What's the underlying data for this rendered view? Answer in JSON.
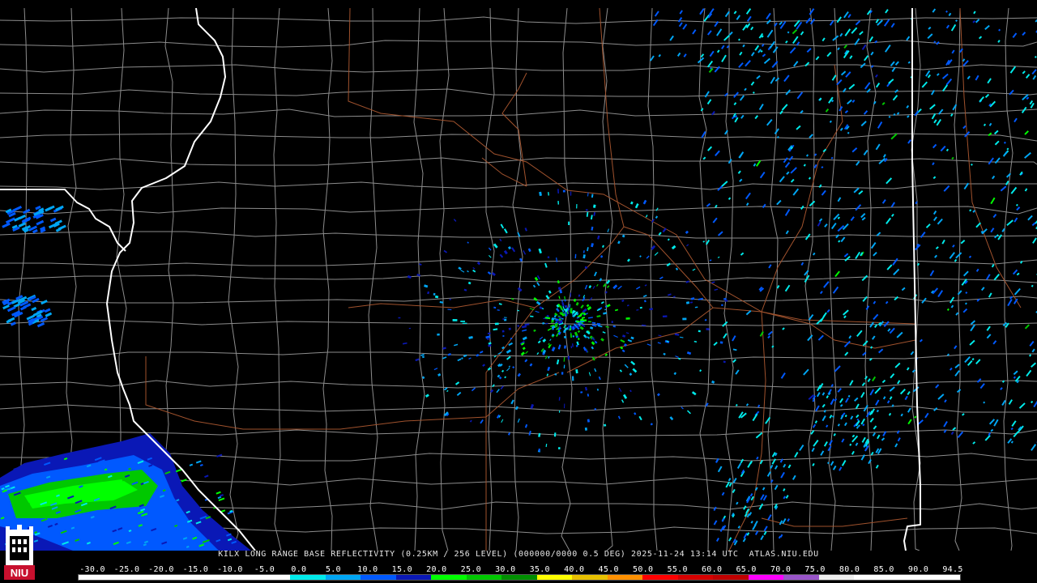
{
  "caption": "KILX LONG RANGE BASE REFLECTIVITY (0.25KM / 256 LEVEL) (000000/0000 0.5 DEG) 2025-11-24 13:14 UTC  ATLAS.NIU.EDU",
  "logo": {
    "text": "NIU",
    "color": "#c8102e",
    "icon": "niu-castle-logo-icon"
  },
  "legend": {
    "ticks": [
      "-30.0",
      "-25.0",
      "-20.0",
      "-15.0",
      "-10.0",
      "-5.0",
      "0.0",
      "5.0",
      "10.0",
      "15.0",
      "20.0",
      "25.0",
      "30.0",
      "35.0",
      "40.0",
      "45.0",
      "50.0",
      "55.0",
      "60.0",
      "65.0",
      "70.0",
      "75.0",
      "80.0",
      "85.0",
      "90.0",
      "94.5"
    ],
    "colors": [
      "#ffffff",
      "#ffffff",
      "#ffffff",
      "#ffffff",
      "#ffffff",
      "#ffffff",
      "#00eaea",
      "#00a6f4",
      "#0059ff",
      "#0a18b6",
      "#00ff00",
      "#00c800",
      "#008f00",
      "#ffff00",
      "#e7c000",
      "#ff9000",
      "#ff0000",
      "#d60000",
      "#c00000",
      "#ff00ff",
      "#9955c9",
      "#eeeeee",
      "#ffffff",
      "#ffffff",
      "#ffffff"
    ]
  },
  "map": {
    "colors": {
      "state_border": "#ffffff",
      "county_line": "#8c8c8c",
      "highway": "#a0522d"
    }
  }
}
